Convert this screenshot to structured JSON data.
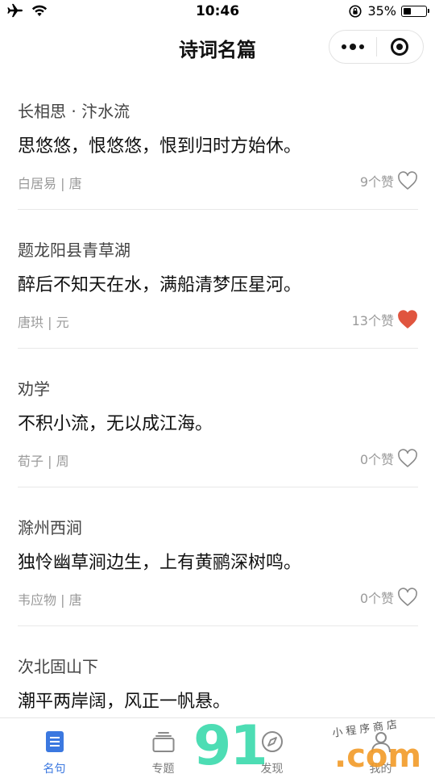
{
  "status_bar": {
    "time": "10:46",
    "battery": "35%",
    "battery_level": 0.35
  },
  "nav": {
    "title": "诗词名篇"
  },
  "poems": [
    {
      "title": "长相思 · 汴水流",
      "line": "思悠悠，恨悠悠，恨到归时方始休。",
      "author": "白居易 | 唐",
      "likes": "9个赞",
      "liked": false
    },
    {
      "title": "题龙阳县青草湖",
      "line": "醉后不知天在水，满船清梦压星河。",
      "author": "唐珙 | 元",
      "likes": "13个赞",
      "liked": true
    },
    {
      "title": "劝学",
      "line": "不积小流，无以成江海。",
      "author": "荀子 | 周",
      "likes": "0个赞",
      "liked": false
    },
    {
      "title": "滁州西涧",
      "line": "独怜幽草涧边生，上有黄鹂深树鸣。",
      "author": "韦应物 | 唐",
      "likes": "0个赞",
      "liked": false
    },
    {
      "title": "次北固山下",
      "line": "潮平两岸阔，风正一帆悬。",
      "author": "",
      "likes": "",
      "liked": false
    }
  ],
  "tabs": [
    {
      "label": "名句",
      "icon": "document-icon",
      "active": true
    },
    {
      "label": "专题",
      "icon": "stack-icon",
      "active": false
    },
    {
      "label": "发现",
      "icon": "compass-icon",
      "active": false
    },
    {
      "label": "我的",
      "icon": "person-icon",
      "active": false
    }
  ],
  "watermark": {
    "number": "91",
    "suffix": ".com",
    "shop": "小程序商店"
  },
  "colors": {
    "accent": "#3b78e0",
    "liked_heart": "#e0553f",
    "muted_text": "#9a9a9a"
  }
}
